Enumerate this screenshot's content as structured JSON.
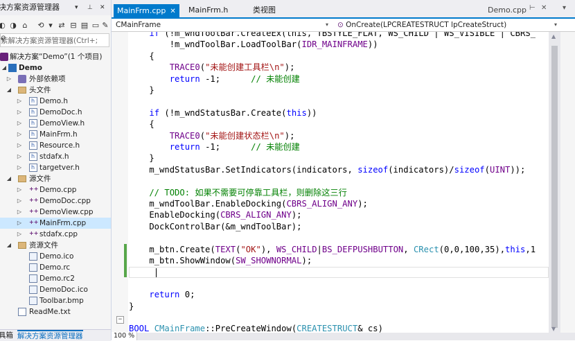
{
  "solution_explorer": {
    "title": "决方案资源管理器",
    "search_placeholder": "索解决方案资源管理器(Ctrl+;",
    "solution_label": "解决方案“Demo”(1 个项目)",
    "project": "Demo",
    "external": "外部依赖项",
    "header_folder": "头文件",
    "headers": [
      "Demo.h",
      "DemoDoc.h",
      "DemoView.h",
      "MainFrm.h",
      "Resource.h",
      "stdafx.h",
      "targetver.h"
    ],
    "source_folder": "源文件",
    "sources": [
      "Demo.cpp",
      "DemoDoc.cpp",
      "DemoView.cpp",
      "MainFrm.cpp",
      "stdafx.cpp"
    ],
    "resource_folder": "资源文件",
    "resources": [
      "Demo.ico",
      "Demo.rc",
      "Demo.rc2",
      "DemoDoc.ico",
      "Toolbar.bmp"
    ],
    "readme": "ReadMe.txt",
    "bottom_tabs": [
      "具箱",
      "解决方案资源管理器"
    ],
    "icons": [
      "pin-icon",
      "close-icon",
      "home-icon",
      "refresh-icon",
      "search-icon"
    ]
  },
  "editor": {
    "tabs": [
      "MainFrm.cpp",
      "MainFrm.h",
      "类视图"
    ],
    "right_tab": "Demo.cpp",
    "class_combo": "CMainFrame",
    "method_combo": "OnCreate(LPCREATESTRUCT lpCreateStruct)",
    "zoom": "100 %",
    "accent": "#007acc"
  },
  "code": [
    [
      [
        "kw",
        "    if"
      ],
      [
        "tx",
        " (!m_wndToolBar.CreateEx(this, TBSTYLE_FLAT, WS_CHILD | WS_VISIBLE | CBRS_"
      ]
    ],
    [
      [
        "tx",
        "        !m_wndToolBar.LoadToolBar("
      ],
      [
        "mc",
        "IDR_MAINFRAME"
      ],
      [
        "tx",
        "))"
      ]
    ],
    [
      [
        "tx",
        "    {"
      ]
    ],
    [
      [
        "tx",
        "        "
      ],
      [
        "mc",
        "TRACE0"
      ],
      [
        "tx",
        "("
      ],
      [
        "st",
        "\"未能创建工具栏\\n\""
      ],
      [
        "tx",
        ");"
      ]
    ],
    [
      [
        "tx",
        "        "
      ],
      [
        "kw",
        "return"
      ],
      [
        "tx",
        " -1;      "
      ],
      [
        "cm",
        "// 未能创建"
      ]
    ],
    [
      [
        "tx",
        "    }"
      ]
    ],
    [
      [
        "tx",
        ""
      ]
    ],
    [
      [
        "tx",
        "    "
      ],
      [
        "kw",
        "if"
      ],
      [
        "tx",
        " (!m_wndStatusBar.Create("
      ],
      [
        "kw",
        "this"
      ],
      [
        "tx",
        "))"
      ]
    ],
    [
      [
        "tx",
        "    {"
      ]
    ],
    [
      [
        "tx",
        "        "
      ],
      [
        "mc",
        "TRACE0"
      ],
      [
        "tx",
        "("
      ],
      [
        "st",
        "\"未能创建状态栏\\n\""
      ],
      [
        "tx",
        ");"
      ]
    ],
    [
      [
        "tx",
        "        "
      ],
      [
        "kw",
        "return"
      ],
      [
        "tx",
        " -1;      "
      ],
      [
        "cm",
        "// 未能创建"
      ]
    ],
    [
      [
        "tx",
        "    }"
      ]
    ],
    [
      [
        "tx",
        "    m_wndStatusBar.SetIndicators(indicators, "
      ],
      [
        "kw",
        "sizeof"
      ],
      [
        "tx",
        "(indicators)/"
      ],
      [
        "kw",
        "sizeof"
      ],
      [
        "tx",
        "("
      ],
      [
        "mc",
        "UINT"
      ],
      [
        "tx",
        "));"
      ]
    ],
    [
      [
        "tx",
        ""
      ]
    ],
    [
      [
        "cm",
        "    // TODO: 如果不需要可停靠工具栏，则删除这三行"
      ]
    ],
    [
      [
        "tx",
        "    m_wndToolBar.EnableDocking("
      ],
      [
        "mc",
        "CBRS_ALIGN_ANY"
      ],
      [
        "tx",
        ");"
      ]
    ],
    [
      [
        "tx",
        "    EnableDocking("
      ],
      [
        "mc",
        "CBRS_ALIGN_ANY"
      ],
      [
        "tx",
        ");"
      ]
    ],
    [
      [
        "tx",
        "    DockControlBar(&m_wndToolBar);"
      ]
    ],
    [
      [
        "tx",
        ""
      ]
    ],
    [
      [
        "tx",
        "    m_btn.Create("
      ],
      [
        "mc",
        "TEXT"
      ],
      [
        "tx",
        "("
      ],
      [
        "st",
        "\"OK\""
      ],
      [
        "tx",
        "), "
      ],
      [
        "mc",
        "WS_CHILD"
      ],
      [
        "tx",
        "|"
      ],
      [
        "mc",
        "BS_DEFPUSHBUTTON"
      ],
      [
        "tx",
        ", "
      ],
      [
        "ty",
        "CRect"
      ],
      [
        "tx",
        "(0,0,100,35),"
      ],
      [
        "kw",
        "this"
      ],
      [
        "tx",
        ",1"
      ]
    ],
    [
      [
        "tx",
        "    m_btn.ShowWindow("
      ],
      [
        "mc",
        "SW_SHOWNORMAL"
      ],
      [
        "tx",
        ");"
      ]
    ],
    [
      [
        "tx",
        "    "
      ]
    ],
    [
      [
        "tx",
        ""
      ]
    ],
    [
      [
        "tx",
        "    "
      ],
      [
        "kw",
        "return"
      ],
      [
        "tx",
        " 0;"
      ]
    ],
    [
      [
        "tx",
        "}"
      ]
    ],
    [
      [
        "tx",
        ""
      ]
    ],
    [
      [
        "kw",
        "BOOL"
      ],
      [
        "tx",
        " "
      ],
      [
        "ty",
        "CMainFrame"
      ],
      [
        "tx",
        "::PreCreateWindow("
      ],
      [
        "ty",
        "CREATESTRUCT"
      ],
      [
        "tx",
        "& cs)"
      ]
    ],
    [
      [
        "tx",
        "{"
      ]
    ]
  ]
}
